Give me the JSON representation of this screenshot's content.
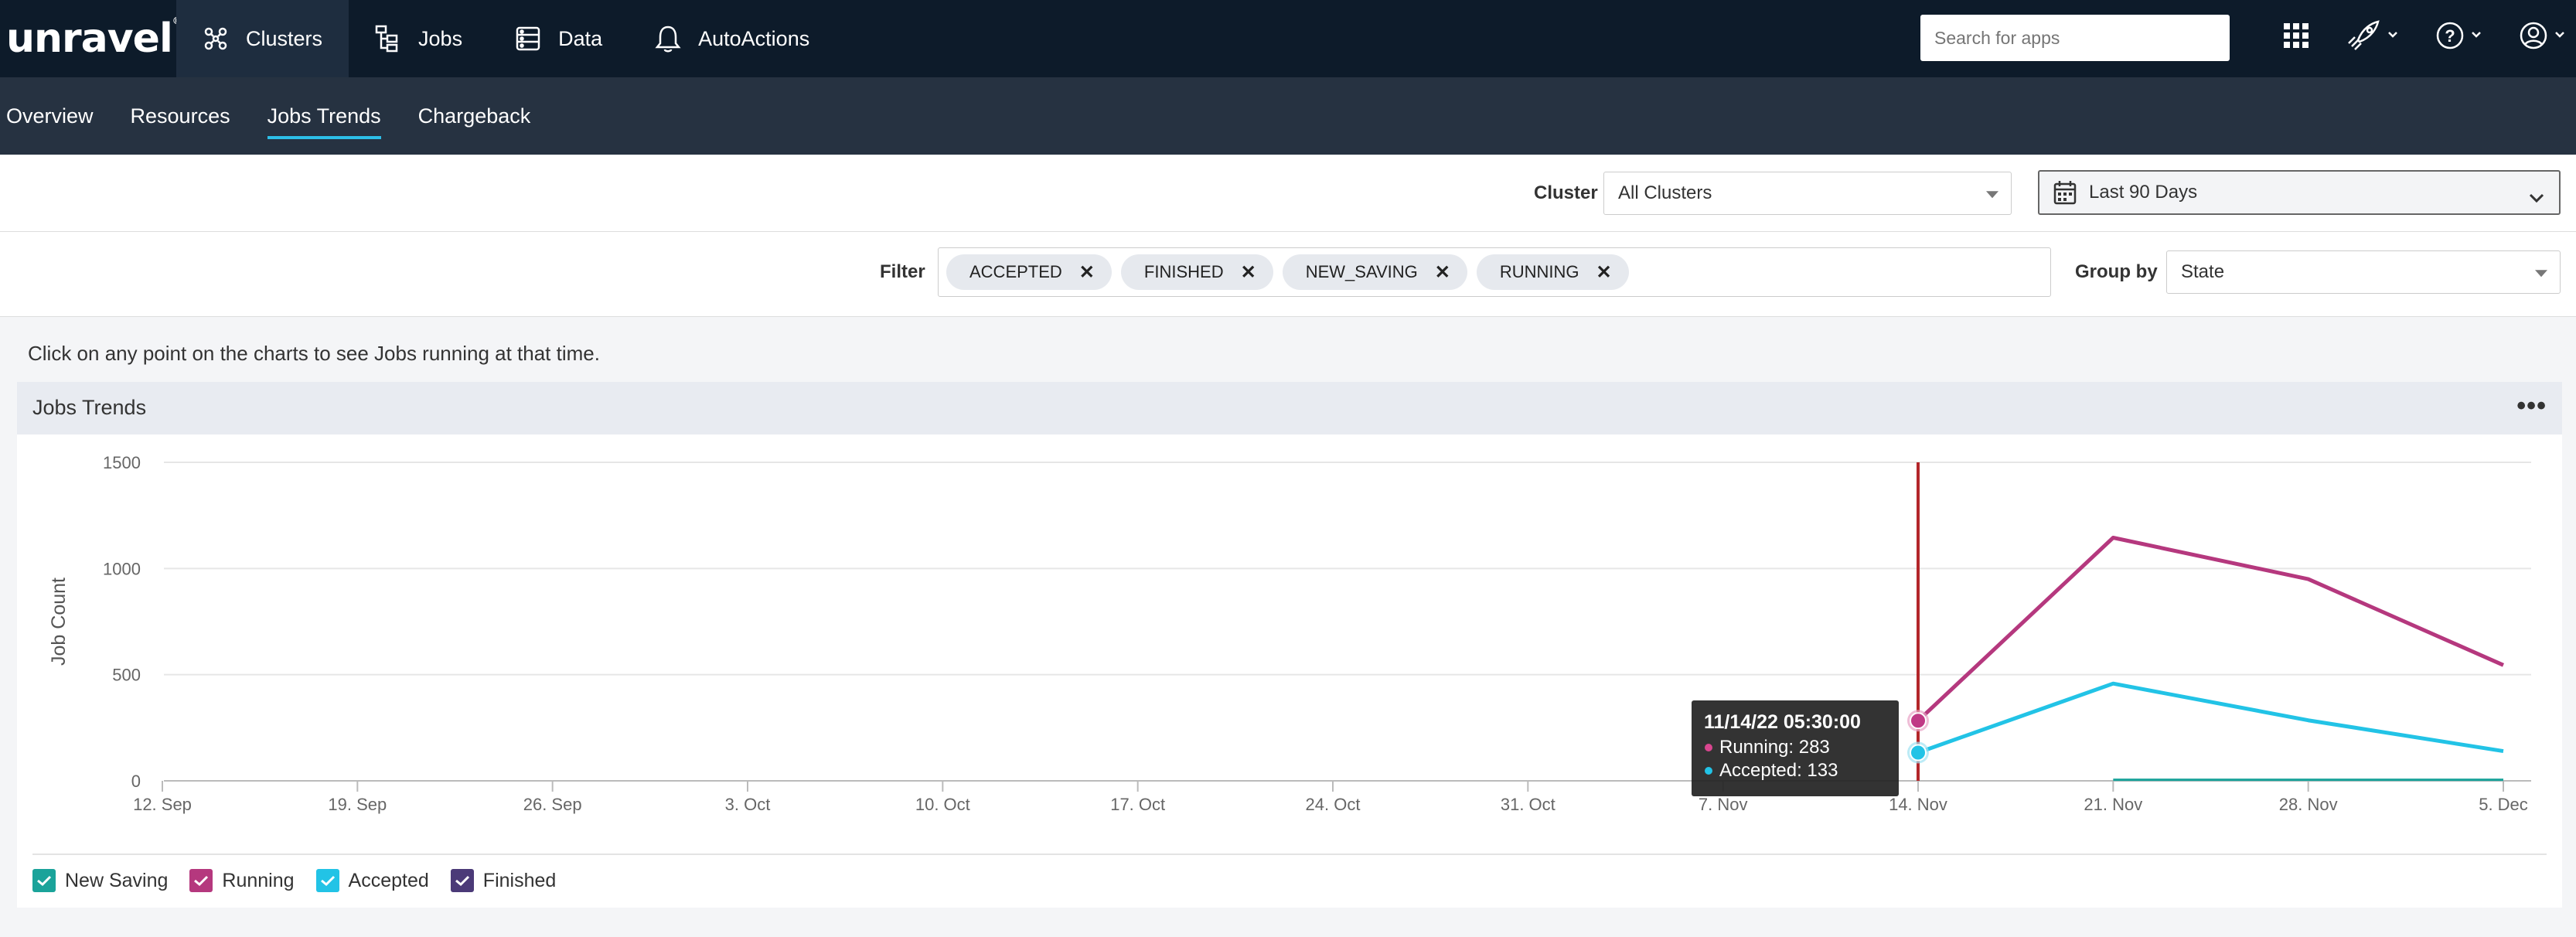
{
  "topnav": {
    "logo": "unravel",
    "items": [
      {
        "label": "Clusters",
        "icon": "clusters-icon",
        "active": true
      },
      {
        "label": "Jobs",
        "icon": "jobs-icon",
        "active": false
      },
      {
        "label": "Data",
        "icon": "data-icon",
        "active": false
      },
      {
        "label": "AutoActions",
        "icon": "bell-icon",
        "active": false
      }
    ],
    "search_placeholder": "Search for apps"
  },
  "subnav": {
    "items": [
      {
        "label": "Overview",
        "active": false
      },
      {
        "label": "Resources",
        "active": false
      },
      {
        "label": "Jobs Trends",
        "active": true
      },
      {
        "label": "Chargeback",
        "active": false
      }
    ]
  },
  "clusterbar": {
    "cluster_label": "Cluster",
    "cluster_value": "All Clusters",
    "date_value": "Last 90 Days"
  },
  "filterbar": {
    "filter_label": "Filter",
    "chips": [
      "ACCEPTED",
      "FINISHED",
      "NEW_SAVING",
      "RUNNING"
    ],
    "groupby_label": "Group by",
    "groupby_value": "State"
  },
  "hint": "Click on any point on the charts to see Jobs running at that time.",
  "panel": {
    "title": "Jobs Trends"
  },
  "chart_data": {
    "type": "line",
    "title": "",
    "ylabel": "Job Count",
    "xlabel": "",
    "ylim": [
      0,
      1500
    ],
    "yticks": [
      0,
      500,
      1000,
      1500
    ],
    "xticks": [
      "12. Sep",
      "19. Sep",
      "26. Sep",
      "3. Oct",
      "10. Oct",
      "17. Oct",
      "24. Oct",
      "31. Oct",
      "7. Nov",
      "14. Nov",
      "21. Nov",
      "28. Nov",
      "5. Dec"
    ],
    "x_domain": [
      "2022-09-12",
      "2022-12-05"
    ],
    "grid": true,
    "legend_placement": "bottom-left",
    "series": [
      {
        "name": "New Saving",
        "color": "#1aa39a",
        "x": [
          "2022-11-21",
          "2022-11-28",
          "2022-12-05"
        ],
        "values": [
          5,
          5,
          5
        ]
      },
      {
        "name": "Running",
        "color": "#b5387e",
        "x": [
          "2022-11-14",
          "2022-11-21",
          "2022-11-28",
          "2022-12-05"
        ],
        "values": [
          283,
          1145,
          950,
          545
        ]
      },
      {
        "name": "Accepted",
        "color": "#22c3e6",
        "x": [
          "2022-11-14",
          "2022-11-21",
          "2022-11-28",
          "2022-12-05"
        ],
        "values": [
          133,
          458,
          285,
          140
        ]
      },
      {
        "name": "Finished",
        "color": "#4b3a78",
        "x": [],
        "values": []
      }
    ],
    "cursor_x": "2022-11-14",
    "tooltip": {
      "header": "11/14/22 05:30:00",
      "rows": [
        {
          "label": "Running: 283",
          "color": "#d9468f"
        },
        {
          "label": "Accepted: 133",
          "color": "#22c3e6"
        }
      ]
    }
  }
}
